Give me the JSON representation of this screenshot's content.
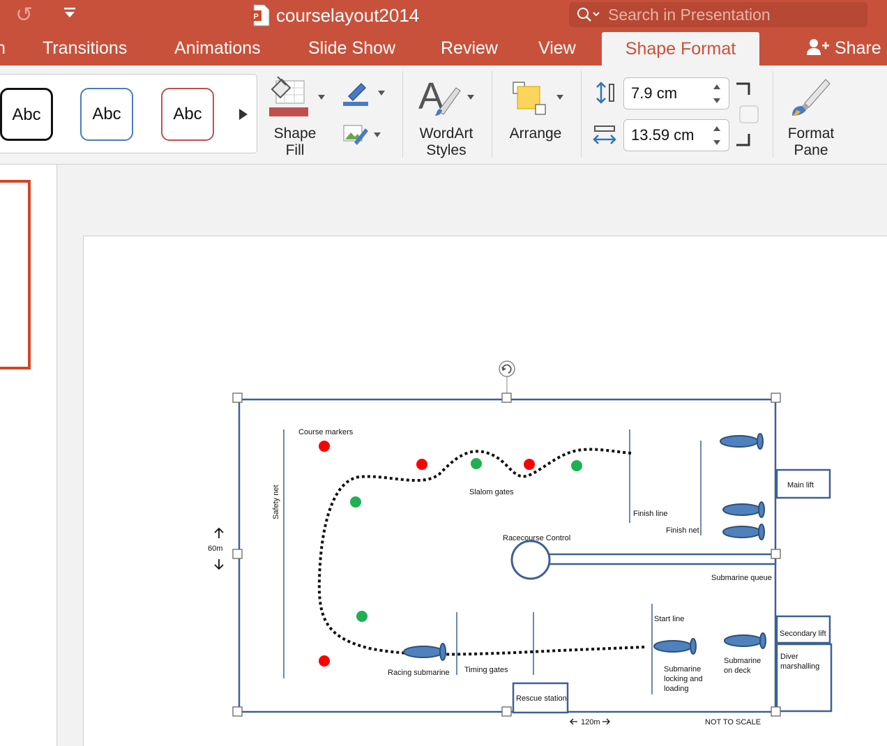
{
  "window": {
    "title": "courselayout2014",
    "search_placeholder": "Search in Presentation"
  },
  "tabs": [
    {
      "label": "n"
    },
    {
      "label": "Transitions"
    },
    {
      "label": "Animations"
    },
    {
      "label": "Slide Show"
    },
    {
      "label": "Review"
    },
    {
      "label": "View"
    },
    {
      "label": "Shape Format",
      "active": true
    }
  ],
  "share_label": "Share",
  "ribbon": {
    "style_thumbs": [
      "Abc",
      "Abc",
      "Abc"
    ],
    "shape_fill_label": "Shape\nFill",
    "wordart_label": "WordArt\nStyles",
    "arrange_label": "Arrange",
    "height_value": "7.9 cm",
    "width_value": "13.59 cm",
    "format_pane_label": "Format\nPane"
  },
  "colors": {
    "accent": "#c8513b",
    "shape_fill_swatch": "#c0504d",
    "line_swatch": "#4a7bbf",
    "diagram_stroke": "#3e6092",
    "submarine_fill": "#4f81bd",
    "marker_red": "#ff0000",
    "marker_green": "#1fb151",
    "selection_handle": "#666666"
  },
  "icons": [
    "undo-icon",
    "customize-toolbar-icon",
    "powerpoint-doc-icon",
    "search-icon",
    "share-icon",
    "shape-fill-bucket-icon",
    "shape-outline-pen-icon",
    "shape-effects-icon",
    "wordart-icon",
    "arrange-icon",
    "height-icon",
    "width-icon",
    "lock-aspect-icon",
    "format-pane-brush-icon",
    "rotate-handle-icon"
  ],
  "diagram": {
    "course_markers": "Course markers",
    "safety_net": "Safety net",
    "slalom_gates": "Slalom gates",
    "finish_line": "Finish line",
    "finish_net": "Finish net",
    "main_lift": "Main lift",
    "racecourse_control": "Racecourse Control",
    "submarine_queue": "Submarine queue",
    "scale_height": "60m",
    "start_line": "Start line",
    "secondary_lift": "Secondary lift",
    "diver_marshalling": [
      "Diver",
      "marshalling"
    ],
    "submarine_on_deck": [
      "Submarine",
      "on deck"
    ],
    "submarine_locking": [
      "Submarine",
      "locking and",
      "loading"
    ],
    "racing_submarine": "Racing submarine",
    "timing_gates": "Timing gates",
    "rescue_station": "Rescue station",
    "scale_width": "120m",
    "not_to_scale": "NOT TO SCALE"
  }
}
